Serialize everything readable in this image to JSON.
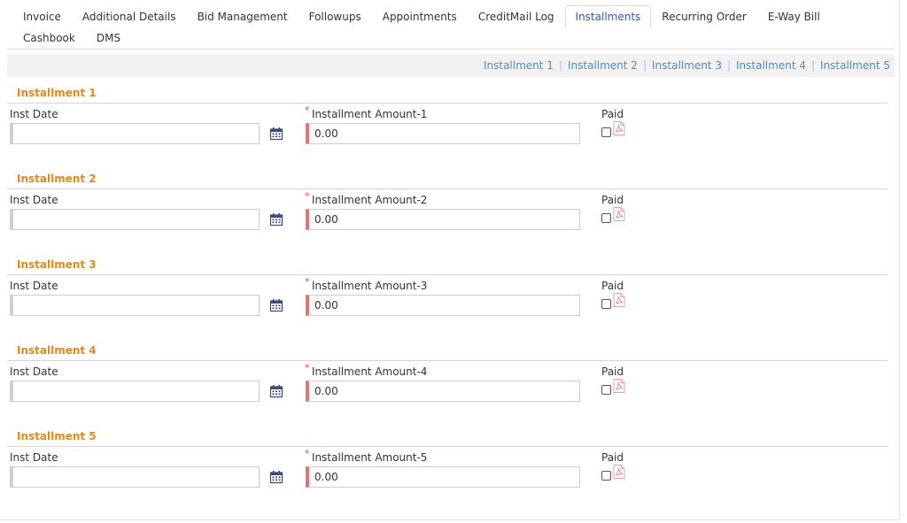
{
  "tabs": [
    {
      "label": "Invoice"
    },
    {
      "label": "Additional Details"
    },
    {
      "label": "Bid Management"
    },
    {
      "label": "Followups"
    },
    {
      "label": "Appointments"
    },
    {
      "label": "CreditMail Log"
    },
    {
      "label": "Installments",
      "active": true
    },
    {
      "label": "Recurring Order"
    },
    {
      "label": "E-Way Bill"
    },
    {
      "label": "Cashbook"
    },
    {
      "label": "DMS"
    }
  ],
  "quick_links": [
    "Installment 1",
    "Installment 2",
    "Installment 3",
    "Installment 4",
    "Installment 5"
  ],
  "link_separator": "|",
  "installments": [
    {
      "title": "Installment 1",
      "date_label": "Inst Date",
      "date_value": "",
      "required_mark": "*",
      "amount_label": "Installment Amount-1",
      "amount_value": "0.00",
      "paid_label": "Paid"
    },
    {
      "title": "Installment 2",
      "date_label": "Inst Date",
      "date_value": "",
      "required_mark": "*",
      "amount_label": "Installment Amount-2",
      "amount_value": "0.00",
      "paid_label": "Paid"
    },
    {
      "title": "Installment 3",
      "date_label": "Inst Date",
      "date_value": "",
      "required_mark": "*",
      "amount_label": "Installment Amount-3",
      "amount_value": "0.00",
      "paid_label": "Paid"
    },
    {
      "title": "Installment 4",
      "date_label": "Inst Date",
      "date_value": "",
      "required_mark": "*",
      "amount_label": "Installment Amount-4",
      "amount_value": "0.00",
      "paid_label": "Paid"
    },
    {
      "title": "Installment 5",
      "date_label": "Inst Date",
      "date_value": "",
      "required_mark": "*",
      "amount_label": "Installment Amount-5",
      "amount_value": "0.00",
      "paid_label": "Paid"
    }
  ],
  "colors": {
    "section_title": "#e08a1e",
    "link": "#4a8cc9",
    "active_tab": "#3d55a8",
    "required": "#d9534f",
    "required_border": "#e57373",
    "pdf_icon": "#e8a0a0",
    "calendar_icon": "#3b4a7a"
  },
  "icons": {
    "calendar": "calendar-icon",
    "pdf": "pdf-icon"
  }
}
